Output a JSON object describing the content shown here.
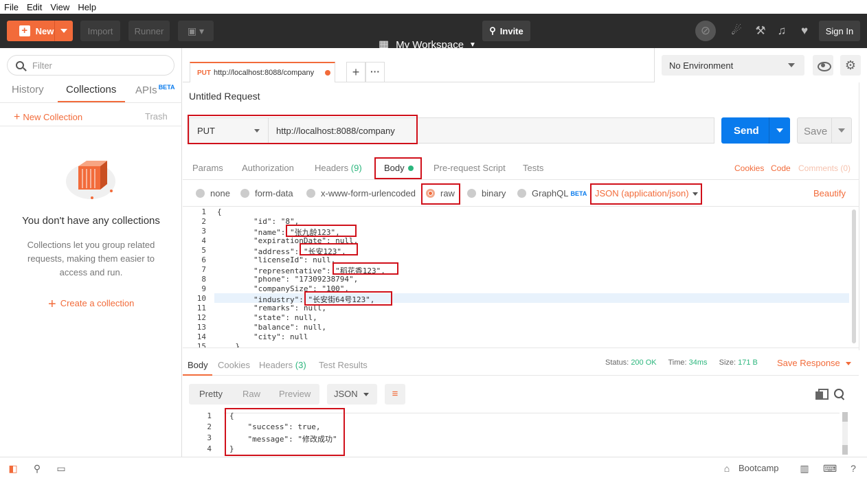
{
  "menu": [
    "File",
    "Edit",
    "View",
    "Help"
  ],
  "topbar": {
    "new_label": "New",
    "import_label": "Import",
    "runner_label": "Runner",
    "workspace_label": "My Workspace",
    "invite_label": "Invite",
    "signin_label": "Sign In"
  },
  "sidebar": {
    "filter_placeholder": "Filter",
    "tabs": [
      "History",
      "Collections",
      "APIs"
    ],
    "apis_badge": "BETA",
    "new_collection": "New Collection",
    "trash": "Trash",
    "empty_title": "You don't have any collections",
    "empty_desc": "Collections let you group related requests, making them easier to access and run.",
    "create_collection": "Create a collection"
  },
  "request_tab": {
    "method": "PUT",
    "url": "http://localhost:8088/company"
  },
  "environment": {
    "selected": "No Environment"
  },
  "request": {
    "title": "Untitled Request",
    "method": "PUT",
    "url": "http://localhost:8088/company",
    "send_label": "Send",
    "save_label": "Save",
    "tabs": [
      "Params",
      "Authorization",
      "Headers",
      "Body",
      "Pre-request Script",
      "Tests"
    ],
    "headers_count": "(9)",
    "links": {
      "cookies": "Cookies",
      "code": "Code",
      "comments": "Comments (0)"
    },
    "body_types": [
      "none",
      "form-data",
      "x-www-form-urlencoded",
      "raw",
      "binary",
      "GraphQL"
    ],
    "graphql_badge": "BETA",
    "content_type": "JSON (application/json)",
    "beautify": "Beautify"
  },
  "editor": {
    "line_numbers": [
      "1",
      "2",
      "3",
      "4",
      "5",
      "6",
      "7",
      "8",
      "9",
      "10",
      "11",
      "12",
      "13",
      "14",
      "15"
    ],
    "lines": [
      "{",
      "        \"id\": \"8\",",
      "        \"name\": \"张九龄123\",",
      "        \"expirationDate\": null,",
      "        \"address\": \"长安123\",",
      "        \"licenseId\": null,",
      "        \"representative\": \"稻花香123\",",
      "        \"phone\": \"17309238794\",",
      "        \"companySize\": \"100\",",
      "        \"industry\": \"长安街64号123\",",
      "        \"remarks\": null,",
      "        \"state\": null,",
      "        \"balance\": null,",
      "        \"city\": null",
      "    }"
    ]
  },
  "response": {
    "tabs": [
      "Body",
      "Cookies",
      "Headers",
      "Test Results"
    ],
    "headers_count": "(3)",
    "status_label": "Status:",
    "status_value": "200 OK",
    "time_label": "Time:",
    "time_value": "34ms",
    "size_label": "Size:",
    "size_value": "171 B",
    "save_response": "Save Response",
    "formats": [
      "Pretty",
      "Raw",
      "Preview"
    ],
    "language": "JSON",
    "line_numbers": [
      "1",
      "2",
      "3",
      "4"
    ],
    "lines": [
      "{",
      "    \"success\": true,",
      "    \"message\": \"修改成功\"",
      "}"
    ]
  },
  "statusbar": {
    "bootcamp": "Bootcamp"
  },
  "colors": {
    "accent": "#f26b3a",
    "send_blue": "#097bed",
    "status_green": "#2cb67d",
    "annotation_red": "#d0101a"
  }
}
